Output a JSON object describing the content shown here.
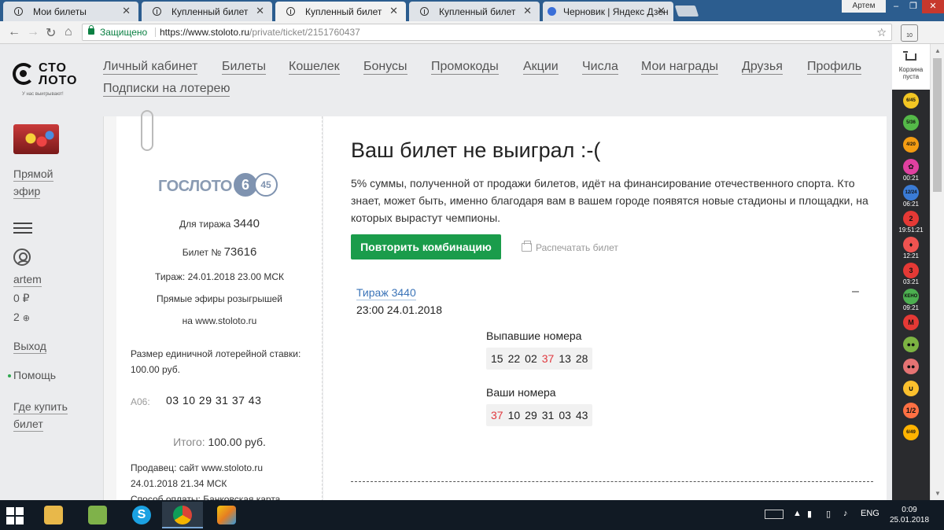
{
  "browser": {
    "tabs": [
      {
        "title": "Мои билеты",
        "icon": "stoloto-icon",
        "active": false
      },
      {
        "title": "Купленный билет",
        "icon": "stoloto-icon",
        "active": false
      },
      {
        "title": "Купленный билет",
        "icon": "stoloto-icon",
        "active": true
      },
      {
        "title": "Купленный билет",
        "icon": "stoloto-icon",
        "active": false
      },
      {
        "title": "Черновик | Яндекс Дзен",
        "icon": "yandex-icon",
        "active": false
      }
    ],
    "close_glyph": "✕",
    "profile_name": "Артем",
    "secure_label": "Защищено",
    "url_host": "https://www.stoloto.ru",
    "url_path": "/private/ticket/2151760437",
    "extension_badge": "10"
  },
  "site": {
    "logo_line1": "СТО",
    "logo_line2": "ЛОТО",
    "logo_tagline": "У нас выигрывают!",
    "nav": [
      "Личный кабинет",
      "Билеты",
      "Кошелек",
      "Бонусы",
      "Промокоды",
      "Акции",
      "Числа",
      "Мои награды",
      "Друзья",
      "Профиль",
      "Подписки на лотерею"
    ]
  },
  "sidebar": {
    "live_label_1": "Прямой",
    "live_label_2": "эфир",
    "username": "artem",
    "balance": "0 ₽",
    "bonus": "2",
    "logout": "Выход",
    "help": "Помощь",
    "where_buy_1": "Где купить",
    "where_buy_2": "билет"
  },
  "ticket": {
    "game_name": "ГОСЛОТО",
    "ball_a": "6",
    "ball_b": "45",
    "draw_label": "Для тиража",
    "draw_number": "3440",
    "ticket_label": "Билет №",
    "ticket_number": "73616",
    "draw_datetime": "Тираж: 24.01.2018 23.00 МСК",
    "broadcast_1": "Прямые эфиры розыгрышей",
    "broadcast_2": "на www.stoloto.ru",
    "stake_1": "Размер единичной лотерейной ставки:",
    "stake_2": "100.00 руб.",
    "combo_label": "А06:",
    "combo_numbers": "03 10 29 31 37 43",
    "total_label": "Итого:",
    "total_value": "100.00 руб.",
    "seller": "Продавец: сайт www.stoloto.ru",
    "sale_datetime": "24.01.2018   21.34 МСК",
    "payment": "Способ оплаты: Банковская карта"
  },
  "result": {
    "title": "Ваш билет не выиграл :-(",
    "description": "5% суммы, полученной от продажи билетов, идёт на финансирование отечественного спорта. Кто знает, может быть, именно благодаря вам в вашем городе появятся новые стадионы и площадки, на которых вырастут чемпионы.",
    "repeat_button": "Повторить комбинацию",
    "print_button": "Распечатать билет",
    "draw_link": "Тираж 3440",
    "draw_time": "23:00 24.01.2018",
    "collapse_glyph": "–",
    "drawn_label": "Выпавшие номера",
    "drawn_numbers": [
      {
        "n": "15",
        "hit": false
      },
      {
        "n": "22",
        "hit": false
      },
      {
        "n": "02",
        "hit": false
      },
      {
        "n": "37",
        "hit": true
      },
      {
        "n": "13",
        "hit": false
      },
      {
        "n": "28",
        "hit": false
      }
    ],
    "yours_label": "Ваши номера",
    "your_numbers": [
      {
        "n": "37",
        "hit": true
      },
      {
        "n": "10",
        "hit": false
      },
      {
        "n": "29",
        "hit": false
      },
      {
        "n": "31",
        "hit": false
      },
      {
        "n": "03",
        "hit": false
      },
      {
        "n": "43",
        "hit": false
      }
    ],
    "hit_color": "#e0383e",
    "accent_green": "#1a9c4b"
  },
  "extension_sidebar": {
    "cart_label_1": "Корзина",
    "cart_label_2": "пуста",
    "items": [
      {
        "badge": "6/45",
        "time": "",
        "color": "#f3c623"
      },
      {
        "badge": "5/36",
        "time": "",
        "color": "#54b948"
      },
      {
        "badge": "4/20",
        "time": "",
        "color": "#f39c12"
      },
      {
        "badge": "✿",
        "time": "00:21",
        "color": "#e040a0"
      },
      {
        "badge": "12/24",
        "time": "06:21",
        "color": "#3a7bd5"
      },
      {
        "badge": "2",
        "time": "19:51:21",
        "color": "#e53935"
      },
      {
        "badge": "♦",
        "time": "12:21",
        "color": "#ef5350"
      },
      {
        "badge": "3",
        "time": "03:21",
        "color": "#e53935"
      },
      {
        "badge": "КЕНО",
        "time": "09:21",
        "color": "#4caf50"
      },
      {
        "badge": "М",
        "time": "",
        "color": "#e53935"
      },
      {
        "badge": "●●",
        "time": "",
        "color": "#7cb342"
      },
      {
        "badge": "●●",
        "time": "",
        "color": "#e57373"
      },
      {
        "badge": "∪",
        "time": "",
        "color": "#fbc02d"
      },
      {
        "badge": "1/2",
        "time": "",
        "color": "#ff7043"
      },
      {
        "badge": "6/49",
        "time": "",
        "color": "#ffb300"
      }
    ]
  },
  "taskbar": {
    "lang": "ENG",
    "time": "0:09",
    "date": "25.01.2018"
  }
}
